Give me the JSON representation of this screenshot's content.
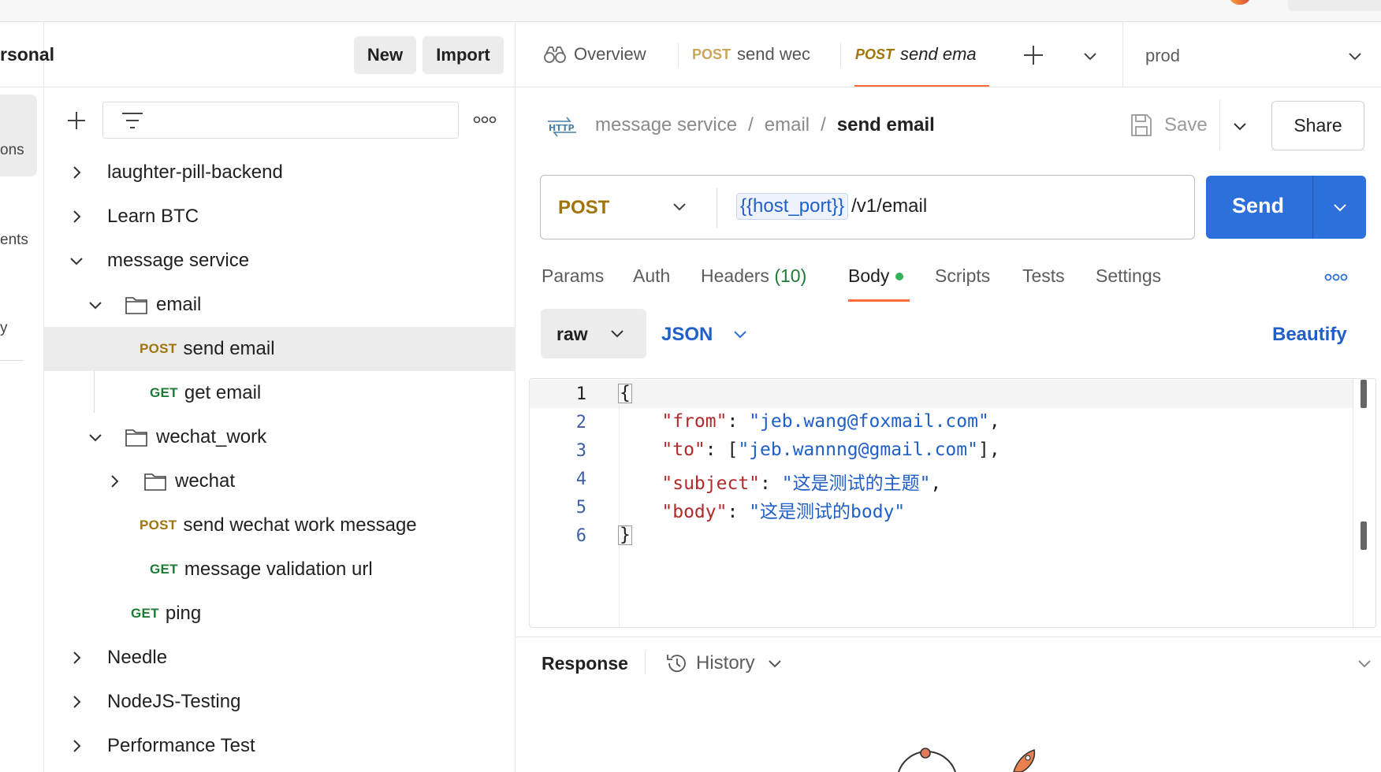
{
  "workspace": {
    "title": "rsonal",
    "new_label": "New",
    "import_label": "Import"
  },
  "rail": {
    "items": [
      "ons",
      "ents",
      "y"
    ]
  },
  "sidebar": {
    "tree": [
      {
        "label": "laughter-pill-backend",
        "type": "collection",
        "expanded": false
      },
      {
        "label": "Learn BTC",
        "type": "collection",
        "expanded": false
      },
      {
        "label": "message service",
        "type": "collection",
        "expanded": true
      },
      {
        "label": "email",
        "type": "folder",
        "expanded": true
      },
      {
        "label": "send email",
        "type": "request",
        "method": "POST",
        "selected": true
      },
      {
        "label": "get email",
        "type": "request",
        "method": "GET"
      },
      {
        "label": "wechat_work",
        "type": "folder",
        "expanded": true
      },
      {
        "label": "wechat",
        "type": "folder",
        "expanded": false
      },
      {
        "label": "send wechat work message",
        "type": "request",
        "method": "POST"
      },
      {
        "label": "message validation url",
        "type": "request",
        "method": "GET"
      },
      {
        "label": "ping",
        "type": "request",
        "method": "GET"
      },
      {
        "label": "Needle",
        "type": "collection",
        "expanded": false
      },
      {
        "label": "NodeJS-Testing",
        "type": "collection",
        "expanded": false
      },
      {
        "label": "Performance Test",
        "type": "collection",
        "expanded": false
      }
    ]
  },
  "tabs": {
    "overview": "Overview",
    "tab1": {
      "method": "POST",
      "label": "send wec"
    },
    "tab2": {
      "method": "POST",
      "label": "send ema"
    },
    "environment": "prod"
  },
  "request": {
    "breadcrumb": [
      "message service",
      "email",
      "send email"
    ],
    "protocol_badge": "HTTP",
    "save_label": "Save",
    "share_label": "Share",
    "method": "POST",
    "url_variable": "{{host_port}}",
    "url_path": "/v1/email",
    "send_label": "Send",
    "tabs": {
      "params": "Params",
      "auth": "Auth",
      "headers": "Headers",
      "headers_count": "(10)",
      "body": "Body",
      "scripts": "Scripts",
      "tests": "Tests",
      "settings": "Settings"
    },
    "body_mode": "raw",
    "body_format": "JSON",
    "beautify_label": "Beautify",
    "line_numbers": [
      "1",
      "2",
      "3",
      "4",
      "5",
      "6"
    ],
    "body_lines": [
      {
        "key": "\"from\"",
        "value": "\"jeb.wang@foxmail.com\""
      },
      {
        "key": "\"to\"",
        "value": "\"jeb.wannng@gmail.com\""
      },
      {
        "key": "\"subject\"",
        "value": "\"这是测试的主题\""
      },
      {
        "key": "\"body\"",
        "value": "\"这是测试的body\""
      }
    ]
  },
  "response": {
    "label": "Response",
    "history_label": "History"
  },
  "colors": {
    "accent": "#ff6c37",
    "send": "#2d6fdb",
    "post": "#a1740a",
    "get": "#1e7b34",
    "link": "#1f5fc7"
  }
}
